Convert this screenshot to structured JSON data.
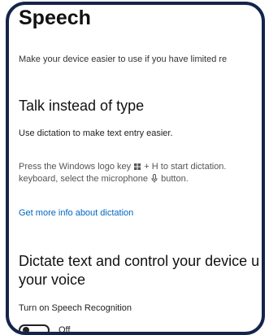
{
  "page": {
    "title": "Speech",
    "subtitle": "Make your device easier to use if you have limited re"
  },
  "dictation": {
    "heading": "Talk instead of type",
    "description": "Use dictation to make text entry easier.",
    "instruction_line1_pre": "Press the Windows logo key",
    "instruction_line1_post": "+ H to start dictation.",
    "instruction_line2_pre": "keyboard, select the microphone",
    "instruction_line2_post": "button.",
    "link": "Get more info about dictation"
  },
  "speech_recognition": {
    "heading_line1": "Dictate text and control your device u",
    "heading_line2": "your voice",
    "toggle_label": "Turn on Speech Recognition",
    "toggle_state": "Off"
  },
  "icons": {
    "windows_key": "windows-logo-icon",
    "microphone": "microphone-icon"
  }
}
